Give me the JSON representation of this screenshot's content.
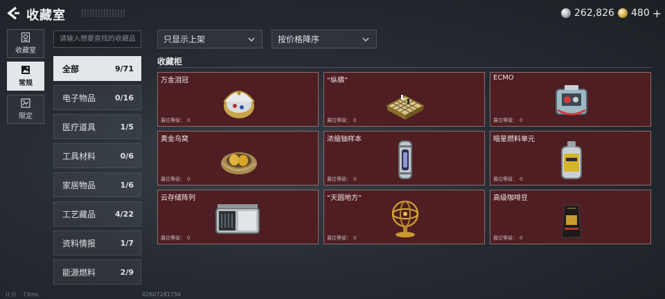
{
  "header": {
    "title": "收藏室",
    "currency": [
      {
        "icon": "silver-coin-icon",
        "value": "262,826"
      },
      {
        "icon": "gold-coin-icon",
        "value": "480"
      }
    ],
    "plus": "+"
  },
  "nav": [
    {
      "label": "收藏室",
      "icon": "vault-icon",
      "active": false
    },
    {
      "label": "常规",
      "icon": "picture-icon",
      "active": true
    },
    {
      "label": "限定",
      "icon": "image-frame-icon",
      "active": false
    }
  ],
  "search": {
    "placeholder": "请输入想要查找的收藏品"
  },
  "categories": [
    {
      "label": "全部",
      "count": "9/71",
      "active": true
    },
    {
      "label": "电子物品",
      "count": "0/16"
    },
    {
      "label": "医疗道具",
      "count": "1/5"
    },
    {
      "label": "工具材料",
      "count": "0/6"
    },
    {
      "label": "家居物品",
      "count": "1/6"
    },
    {
      "label": "工艺藏品",
      "count": "4/22"
    },
    {
      "label": "资料情报",
      "count": "1/7"
    },
    {
      "label": "能源燃料",
      "count": "2/9"
    }
  ],
  "filters": {
    "display": "只显示上架",
    "sort": "按价格降序"
  },
  "section": {
    "label": "收藏柜"
  },
  "cards": [
    {
      "name": "万金泪冠",
      "level_label": "展位等级：",
      "level": "0",
      "icon": "jeweled-egg-icon"
    },
    {
      "name": "“纵横”",
      "level_label": "展位等级：",
      "level": "0",
      "icon": "chessboard-icon"
    },
    {
      "name": "ECMO",
      "level_label": "展位等级：",
      "level": "0",
      "icon": "ecmo-machine-icon"
    },
    {
      "name": "黄金鸟窝",
      "level_label": "展位等级：",
      "level": "0",
      "icon": "golden-nest-icon"
    },
    {
      "name": "浓缩铀样本",
      "level_label": "展位等级：",
      "level": "0",
      "icon": "uranium-canister-icon"
    },
    {
      "name": "暗星燃料单元",
      "level_label": "展位等级：",
      "level": "0",
      "icon": "fuel-cell-icon"
    },
    {
      "name": "云存储阵列",
      "level_label": "展位等级：",
      "level": "0",
      "icon": "storage-array-icon"
    },
    {
      "name": "“天圆地方”",
      "level_label": "展位等级：",
      "level": "0",
      "icon": "armillary-sphere-icon"
    },
    {
      "name": "高级咖啡豆",
      "level_label": "展位等级：",
      "level": "0",
      "icon": "coffee-bag-icon"
    }
  ],
  "footer": {
    "ping": "73ms",
    "uid": "02607281756"
  }
}
